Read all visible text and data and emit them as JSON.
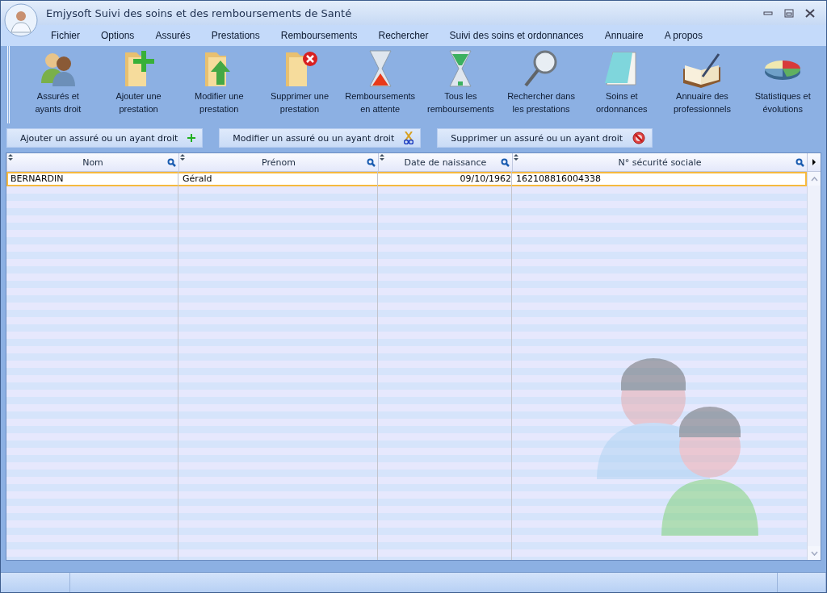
{
  "window": {
    "title": "Emjysoft Suivi des soins et des remboursements de Santé"
  },
  "menu": [
    "Fichier",
    "Options",
    "Assurés",
    "Prestations",
    "Remboursements",
    "Rechercher",
    "Suivi des soins et ordonnances",
    "Annuaire",
    "A propos"
  ],
  "toolbar": [
    {
      "kind": "people",
      "label": "Assurés et\nayants droit"
    },
    {
      "kind": "folder-add",
      "label": "Ajouter une\nprestation"
    },
    {
      "kind": "folder-edit",
      "label": "Modifier une\nprestation"
    },
    {
      "kind": "folder-delete",
      "label": "Supprimer une\nprestation"
    },
    {
      "kind": "hourglass-red",
      "label": "Remboursements\nen attente"
    },
    {
      "kind": "hourglass-green",
      "label": "Tous les\nremboursements"
    },
    {
      "kind": "magnifier",
      "label": "Rechercher dans\nles prestations"
    },
    {
      "kind": "notepad",
      "label": "Soins et\nordonnances"
    },
    {
      "kind": "book",
      "label": "Annuaire des\nprofessionnels"
    },
    {
      "kind": "pie",
      "label": "Statistiques et\névolutions"
    }
  ],
  "actions": [
    {
      "kind": "add",
      "label": "Ajouter un assuré ou un ayant droit"
    },
    {
      "kind": "edit",
      "label": "Modifier un assuré ou un ayant droit"
    },
    {
      "kind": "delete",
      "label": "Supprimer un assuré ou un ayant droit"
    }
  ],
  "table": {
    "columns": [
      "Nom",
      "Prénom",
      "Date de naissance",
      "N° sécurité sociale"
    ],
    "rows": [
      {
        "selected": true,
        "cells": [
          "BERNARDIN",
          "Gérald",
          "09/10/1962",
          "162108816004338"
        ]
      }
    ]
  }
}
